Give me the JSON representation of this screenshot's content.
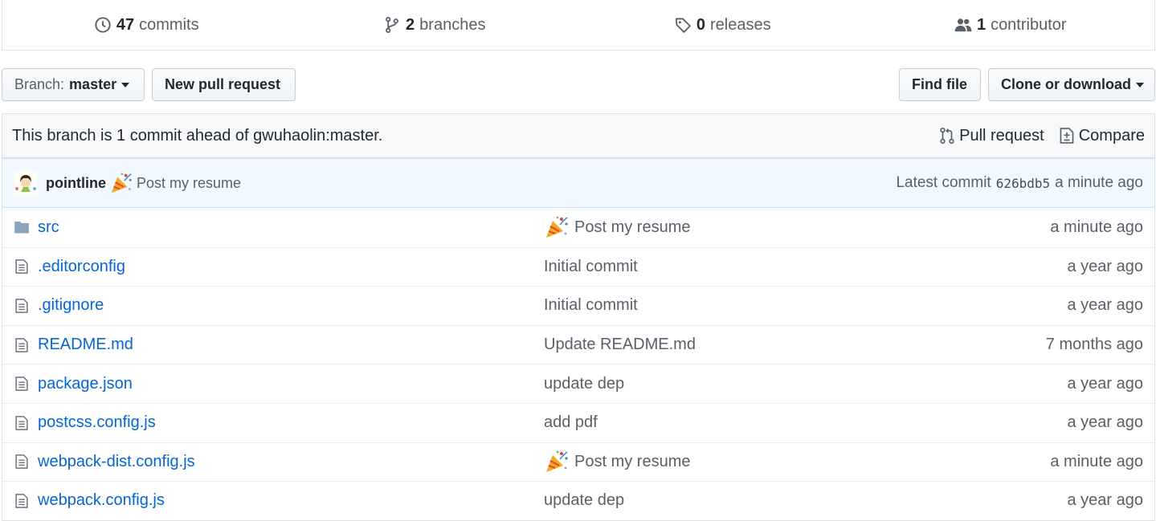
{
  "summary": {
    "commits": {
      "num": "47",
      "label": "commits"
    },
    "branches": {
      "num": "2",
      "label": "branches"
    },
    "releases": {
      "num": "0",
      "label": "releases"
    },
    "contributors": {
      "num": "1",
      "label": "contributor"
    }
  },
  "toolbar": {
    "branch_prefix": "Branch:",
    "branch_name": "master",
    "new_pr": "New pull request",
    "find_file": "Find file",
    "clone": "Clone or download"
  },
  "ahead": {
    "text": "This branch is 1 commit ahead of gwuhaolin:master.",
    "pull_request": "Pull request",
    "compare": "Compare"
  },
  "latest_commit": {
    "author": "pointline",
    "message": "Post my resume",
    "prefix": "Latest commit",
    "sha": "626bdb5",
    "age": "a minute ago"
  },
  "files": [
    {
      "name": "src",
      "type": "folder",
      "message": "Post my resume",
      "emoji": true,
      "age": "a minute ago"
    },
    {
      "name": ".editorconfig",
      "type": "file",
      "message": "Initial commit",
      "emoji": false,
      "age": "a year ago"
    },
    {
      "name": ".gitignore",
      "type": "file",
      "message": "Initial commit",
      "emoji": false,
      "age": "a year ago"
    },
    {
      "name": "README.md",
      "type": "file",
      "message": "Update README.md",
      "emoji": false,
      "age": "7 months ago"
    },
    {
      "name": "package.json",
      "type": "file",
      "message": "update dep",
      "emoji": false,
      "age": "a year ago"
    },
    {
      "name": "postcss.config.js",
      "type": "file",
      "message": "add pdf",
      "emoji": false,
      "age": "a year ago"
    },
    {
      "name": "webpack-dist.config.js",
      "type": "file",
      "message": "Post my resume",
      "emoji": true,
      "age": "a minute ago"
    },
    {
      "name": "webpack.config.js",
      "type": "file",
      "message": "update dep",
      "emoji": false,
      "age": "a year ago"
    }
  ],
  "colors": {
    "link": "#0366d6",
    "muted": "#586069",
    "commit_bg": "#f1f8ff",
    "folder": "#79b8ff"
  },
  "icons": [
    "history-icon",
    "branch-icon",
    "tag-icon",
    "people-icon",
    "pull-request-icon",
    "compare-icon",
    "folder-icon",
    "file-icon",
    "party-popper-icon"
  ]
}
